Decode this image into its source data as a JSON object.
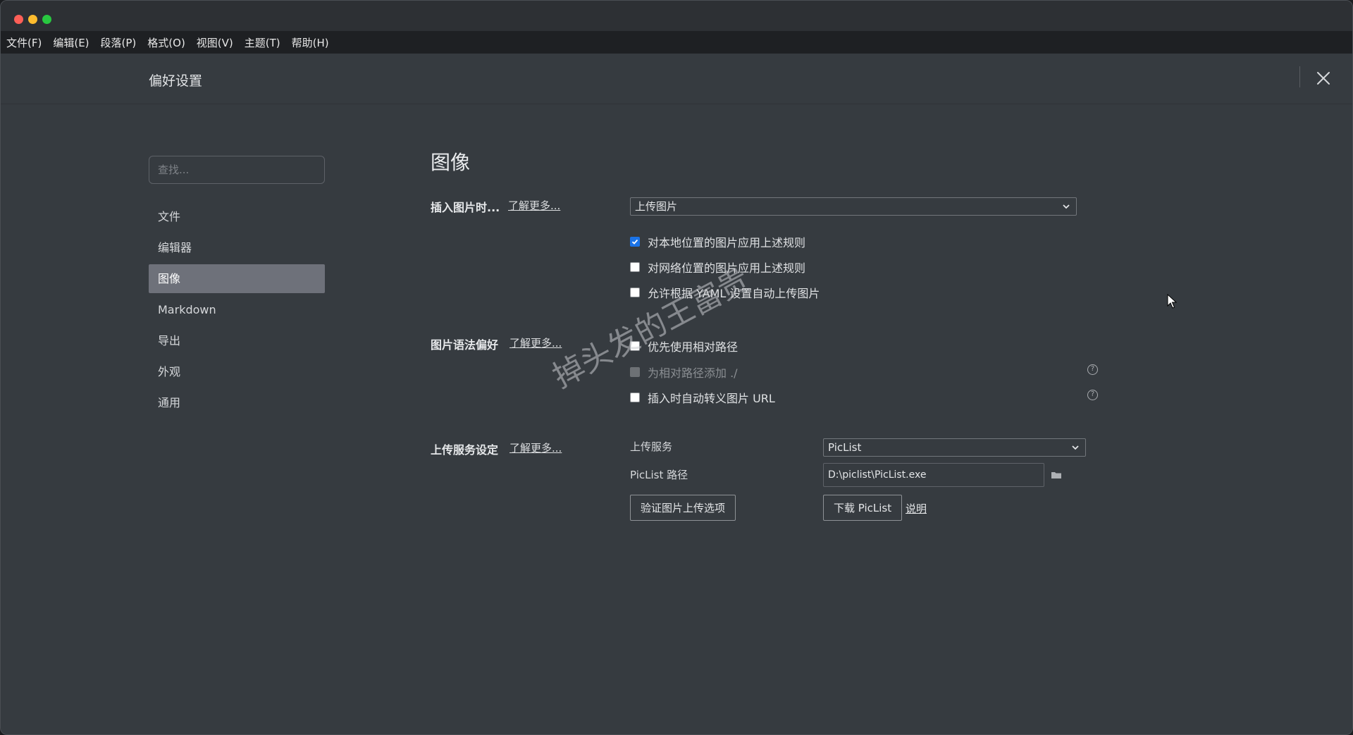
{
  "menu": [
    "文件(F)",
    "编辑(E)",
    "段落(P)",
    "格式(O)",
    "视图(V)",
    "主题(T)",
    "帮助(H)"
  ],
  "header": {
    "title": "偏好设置"
  },
  "sidebar": {
    "search_placeholder": "查找...",
    "items": [
      {
        "label": "文件"
      },
      {
        "label": "编辑器"
      },
      {
        "label": "图像",
        "active": true
      },
      {
        "label": "Markdown"
      },
      {
        "label": "导出"
      },
      {
        "label": "外观"
      },
      {
        "label": "通用"
      }
    ]
  },
  "main": {
    "title": "图像",
    "insert": {
      "label": "插入图片时...",
      "learn_more": "了解更多...",
      "select_value": "上传图片",
      "options": [
        {
          "label": "对本地位置的图片应用上述规则",
          "checked": true
        },
        {
          "label": "对网络位置的图片应用上述规则",
          "checked": false
        },
        {
          "label": "允许根据 YAML 设置自动上传图片",
          "checked": false
        }
      ]
    },
    "syntax": {
      "label": "图片语法偏好",
      "learn_more": "了解更多...",
      "options": [
        {
          "label": "优先使用相对路径",
          "checked": false
        },
        {
          "label": "为相对路径添加 ./",
          "checked": false,
          "disabled": true
        },
        {
          "label": "插入时自动转义图片 URL",
          "checked": false
        }
      ]
    },
    "upload": {
      "label": "上传服务设定",
      "learn_more": "了解更多...",
      "service_label": "上传服务",
      "service_value": "PicList",
      "path_label": "PicList 路径",
      "path_value": "D:\\piclist\\PicList.exe",
      "verify_button": "验证图片上传选项",
      "download_button": "下载 PicList",
      "help_link": "说明"
    }
  },
  "watermark": "掉头发的王富贵",
  "colors": {
    "checkbox_checked": "#1a73e8",
    "sidebar_active": "#6e717a",
    "window_bg": "#363b40"
  }
}
